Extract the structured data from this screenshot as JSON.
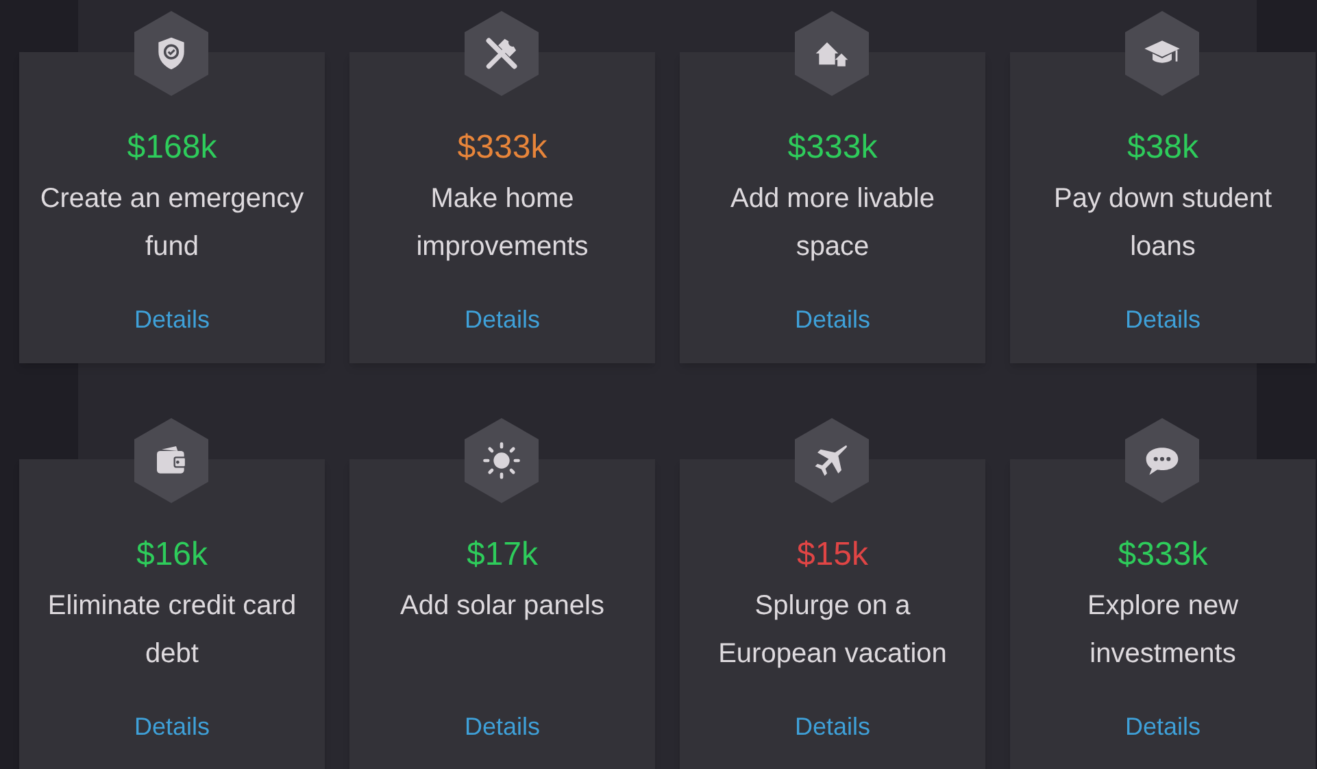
{
  "goals": [
    {
      "amount": "$168k",
      "color": "#2ecc5b",
      "title": "Create an emergency fund",
      "link": "Details"
    },
    {
      "amount": "$333k",
      "color": "#e8853a",
      "title": "Make home improvements",
      "link": "Details"
    },
    {
      "amount": "$333k",
      "color": "#2ecc5b",
      "title": "Add more livable space",
      "link": "Details"
    },
    {
      "amount": "$38k",
      "color": "#2ecc5b",
      "title": "Pay down student loans",
      "link": "Details"
    },
    {
      "amount": "$16k",
      "color": "#2ecc5b",
      "title": "Eliminate credit card debt",
      "link": "Details"
    },
    {
      "amount": "$17k",
      "color": "#2ecc5b",
      "title": "Add solar panels",
      "link": "Details"
    },
    {
      "amount": "$15k",
      "color": "#e04545",
      "title": "Splurge on a European vacation",
      "link": "Details"
    },
    {
      "amount": "$333k",
      "color": "#2ecc5b",
      "title": "Explore new investments",
      "link": "Details"
    }
  ]
}
